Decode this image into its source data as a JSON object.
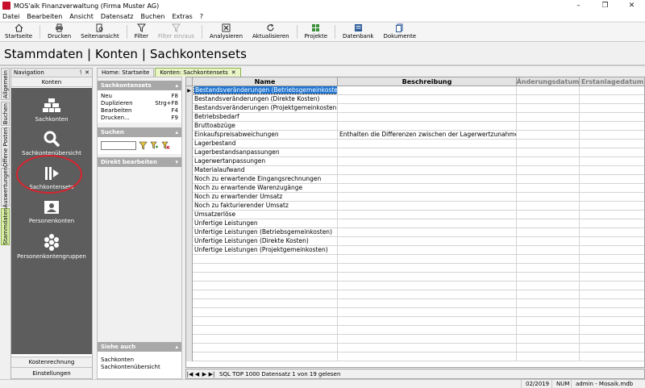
{
  "window": {
    "title": "MOS'aik Finanzverwaltung (Firma Muster AG)",
    "controls": [
      "–",
      "❐",
      "✕"
    ]
  },
  "menu": [
    "Datei",
    "Bearbeiten",
    "Ansicht",
    "Datensatz",
    "Buchen",
    "Extras",
    "?"
  ],
  "toolbar": [
    {
      "label": "Startseite",
      "icon": "home-icon",
      "enabled": true
    },
    {
      "label": "Drucken",
      "icon": "printer-icon",
      "enabled": true
    },
    {
      "label": "Seitenansicht",
      "icon": "page-preview-icon",
      "enabled": true
    },
    {
      "label": "Filter",
      "icon": "filter-icon",
      "enabled": true
    },
    {
      "label": "Filter ein/aus",
      "icon": "filter-toggle-icon",
      "enabled": false
    },
    {
      "label": "Analysieren",
      "icon": "analyze-icon",
      "enabled": true
    },
    {
      "label": "Aktualisieren",
      "icon": "refresh-icon",
      "enabled": true
    },
    {
      "label": "Projekte",
      "icon": "projects-icon",
      "enabled": true
    },
    {
      "label": "Datenbank",
      "icon": "database-icon",
      "enabled": true
    },
    {
      "label": "Dokumente",
      "icon": "documents-icon",
      "enabled": true
    }
  ],
  "page_heading": "Stammdaten | Konten | Sachkontensets",
  "vertical_tabs": [
    "Allgemein",
    "Buchen",
    "Offene Posten",
    "Auswertungen",
    "Stammdaten"
  ],
  "navigation": {
    "title": "Navigation",
    "pin": "ᛩ",
    "close": "✕",
    "section": "Konten",
    "items": [
      {
        "label": "Sachkonten",
        "icon": "bricks-icon"
      },
      {
        "label": "Sachkontenübersicht",
        "icon": "magnifier-icon"
      },
      {
        "label": "Sachkontensets",
        "icon": "sets-icon"
      },
      {
        "label": "Personenkonten",
        "icon": "person-card-icon"
      },
      {
        "label": "Personenkontengruppen",
        "icon": "hexagon-group-icon"
      }
    ],
    "bottom": [
      "Kostenrechnung",
      "Einstellungen"
    ]
  },
  "doc_tabs": [
    {
      "label": "Home: Startseite",
      "active": false
    },
    {
      "label": "Konten: Sachkontensets",
      "active": true
    }
  ],
  "task_pane": {
    "sachkontensets": {
      "title": "Sachkontensets",
      "actions": [
        {
          "label": "Neu",
          "shortcut": "F8"
        },
        {
          "label": "Duplizieren",
          "shortcut": "Strg+F8"
        },
        {
          "label": "Bearbeiten",
          "shortcut": "F4"
        },
        {
          "label": "Drucken...",
          "shortcut": "F9"
        }
      ]
    },
    "suchen": {
      "title": "Suchen"
    },
    "direkt": {
      "title": "Direkt bearbeiten"
    },
    "siehe_auch": {
      "title": "Siehe auch",
      "links": [
        "Sachkonten",
        "Sachkontenübersicht"
      ]
    },
    "chevron_up": "▴",
    "chevron_down": "▾"
  },
  "grid": {
    "columns": [
      "Name",
      "Beschreibung",
      "Änderungsdatum",
      "Erstanlagedatum"
    ],
    "rows": [
      [
        "Bestandsveränderungen (Betriebsgemeinkosten)",
        ""
      ],
      [
        "Bestandsveränderungen (Direkte Kosten)",
        ""
      ],
      [
        "Bestandsveränderungen (Projektgemeinkosten)",
        ""
      ],
      [
        "Betriebsbedarf",
        ""
      ],
      [
        "Bruttoabzüge",
        ""
      ],
      [
        "Einkaufspreisabweichungen",
        "Enthalten die Differenzen zwischen der Lagerwertzunahme"
      ],
      [
        "Lagerbestand",
        ""
      ],
      [
        "Lagerbestandsanpassungen",
        ""
      ],
      [
        "Lagerwertanpassungen",
        ""
      ],
      [
        "Materialaufwand",
        ""
      ],
      [
        "Noch zu erwartende Eingangsrechnungen",
        ""
      ],
      [
        "Noch zu erwartende Warenzugänge",
        ""
      ],
      [
        "Noch zu erwartender Umsatz",
        ""
      ],
      [
        "Noch zu fakturierender Umsatz",
        ""
      ],
      [
        "Umsatzerlöse",
        ""
      ],
      [
        "Unfertige Leistungen",
        ""
      ],
      [
        "Unfertige Leistungen (Betriebsgemeinkosten)",
        ""
      ],
      [
        "Unfertige Leistungen (Direkte Kosten)",
        ""
      ],
      [
        "Unfertige Leistungen (Projektgemeinkosten)",
        ""
      ]
    ],
    "selected_row": 0,
    "current_row_marker": "▶"
  },
  "grid_nav": {
    "buttons": [
      "|◀",
      "◀",
      "▶",
      "▶|"
    ],
    "status": "SQL TOP 1000 Datensatz 1 von 19 gelesen"
  },
  "status_bar": [
    "02/2019",
    "NUM",
    "admin - Mosaik.mdb"
  ]
}
